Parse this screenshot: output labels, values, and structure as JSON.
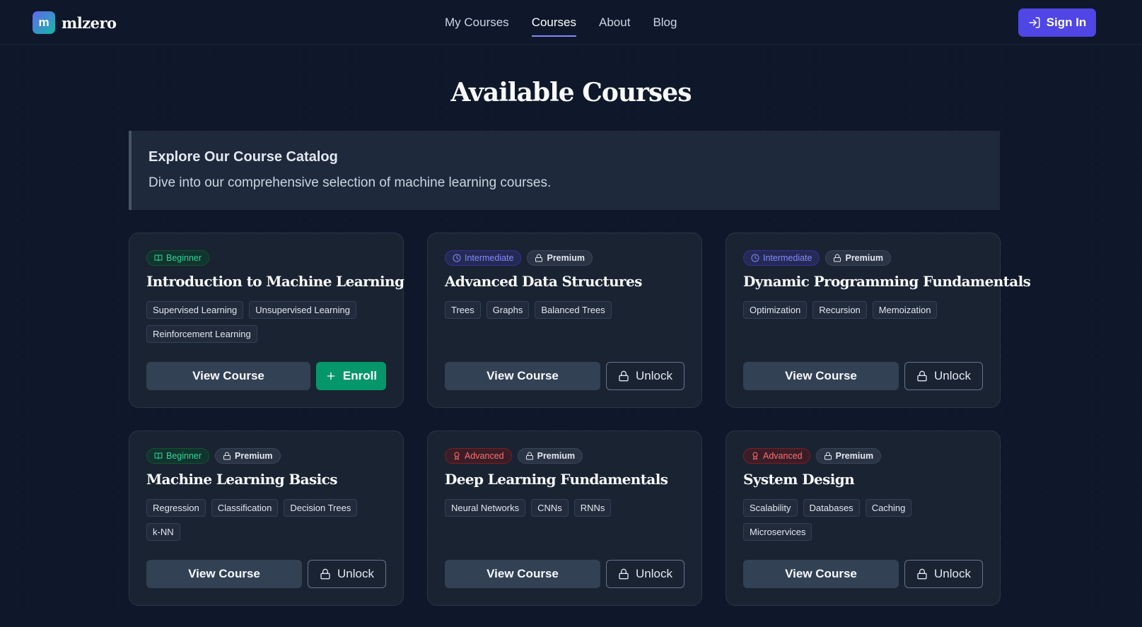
{
  "header": {
    "logo_letter": "m",
    "logo_text": "mlzero",
    "nav": [
      {
        "label": "My Courses",
        "active": false
      },
      {
        "label": "Courses",
        "active": true
      },
      {
        "label": "About",
        "active": false
      },
      {
        "label": "Blog",
        "active": false
      }
    ],
    "signin_label": "Sign In"
  },
  "page_title": "Available Courses",
  "intro": {
    "heading": "Explore Our Course Catalog",
    "text": "Dive into our comprehensive selection of machine learning courses."
  },
  "courses": [
    {
      "level": "Beginner",
      "premium": false,
      "title": "Introduction to Machine Learning",
      "tags": [
        "Supervised Learning",
        "Unsupervised Learning",
        "Reinforcement Learning"
      ],
      "primary": "View Course",
      "secondary": "Enroll",
      "secondary_type": "enroll"
    },
    {
      "level": "Intermediate",
      "premium": true,
      "title": "Advanced Data Structures",
      "tags": [
        "Trees",
        "Graphs",
        "Balanced Trees"
      ],
      "primary": "View Course",
      "secondary": "Unlock",
      "secondary_type": "unlock"
    },
    {
      "level": "Intermediate",
      "premium": true,
      "title": "Dynamic Programming Fundamentals",
      "tags": [
        "Optimization",
        "Recursion",
        "Memoization"
      ],
      "primary": "View Course",
      "secondary": "Unlock",
      "secondary_type": "unlock"
    },
    {
      "level": "Beginner",
      "premium": true,
      "title": "Machine Learning Basics",
      "tags": [
        "Regression",
        "Classification",
        "Decision Trees",
        "k-NN"
      ],
      "primary": "View Course",
      "secondary": "Unlock",
      "secondary_type": "unlock"
    },
    {
      "level": "Advanced",
      "premium": true,
      "title": "Deep Learning Fundamentals",
      "tags": [
        "Neural Networks",
        "CNNs",
        "RNNs"
      ],
      "primary": "View Course",
      "secondary": "Unlock",
      "secondary_type": "unlock"
    },
    {
      "level": "Advanced",
      "premium": true,
      "title": "System Design",
      "tags": [
        "Scalability",
        "Databases",
        "Caching",
        "Microservices"
      ],
      "primary": "View Course",
      "secondary": "Unlock",
      "secondary_type": "unlock"
    }
  ],
  "premium_label": "Premium",
  "colors": {
    "accent": "#4f46e5",
    "beginner": "#34d399",
    "intermediate": "#818cf8",
    "advanced": "#f87171",
    "enroll": "#059669"
  }
}
